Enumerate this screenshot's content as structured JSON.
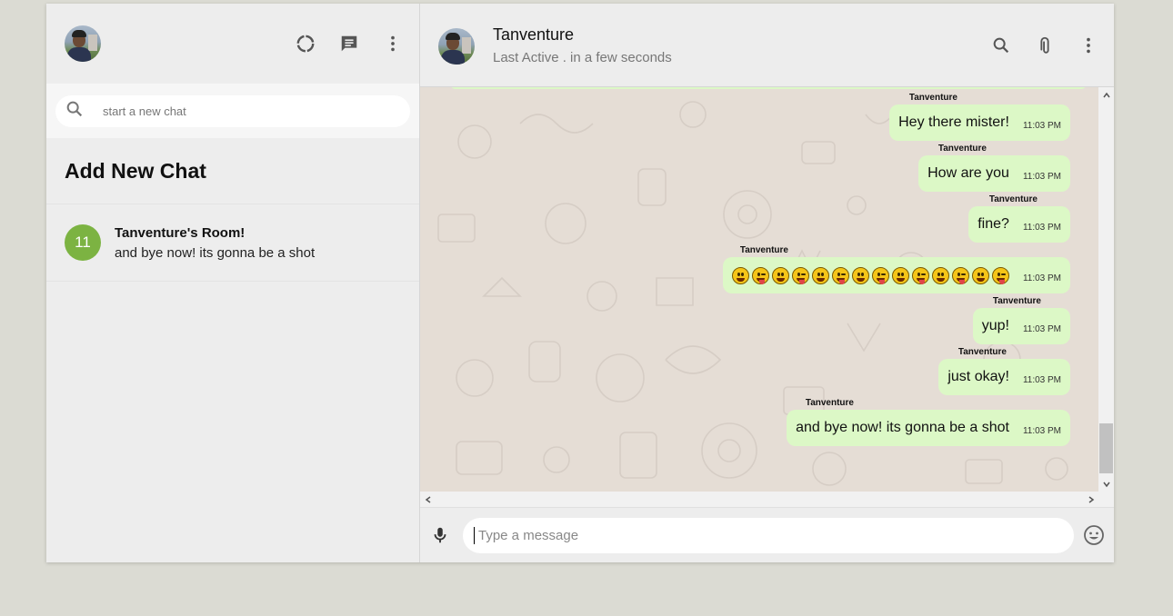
{
  "sidebar": {
    "search_placeholder": "start a new chat",
    "add_new_chat": "Add New Chat",
    "rooms": [
      {
        "badge": "11",
        "name": "Tanventure's Room!",
        "last_message": "and bye now! its gonna be a shot"
      }
    ]
  },
  "chat": {
    "name": "Tanventure",
    "status": "Last Active . in a few seconds",
    "messages": [
      {
        "sender": "Tanventure",
        "text": "Hey there mister!",
        "time": "11:03 PM"
      },
      {
        "sender": "Tanventure",
        "text": "How are you",
        "time": "11:03 PM"
      },
      {
        "sender": "Tanventure",
        "text": "fine?",
        "time": "11:03 PM"
      },
      {
        "sender": "Tanventure",
        "text": "😀😜😀😜😀😜😀😜😀😜😀😜😀😜",
        "time": "11:03 PM"
      },
      {
        "sender": "Tanventure",
        "text": "yup!",
        "time": "11:03 PM"
      },
      {
        "sender": "Tanventure",
        "text": "just okay!",
        "time": "11:03 PM"
      },
      {
        "sender": "Tanventure",
        "text": "and bye now! its gonna be a shot",
        "time": "11:03 PM"
      }
    ],
    "input_placeholder": "Type a message"
  },
  "icons": {
    "status": "status-ring-icon",
    "new_chat": "chat-icon",
    "menu": "more-vert-icon",
    "search": "search-icon",
    "attach": "attach-icon",
    "mic": "mic-icon",
    "emoji": "emoji-icon"
  },
  "colors": {
    "bubble": "#dcf8c6",
    "room_badge": "#7cb342",
    "chat_bg": "#e5ddd5"
  }
}
